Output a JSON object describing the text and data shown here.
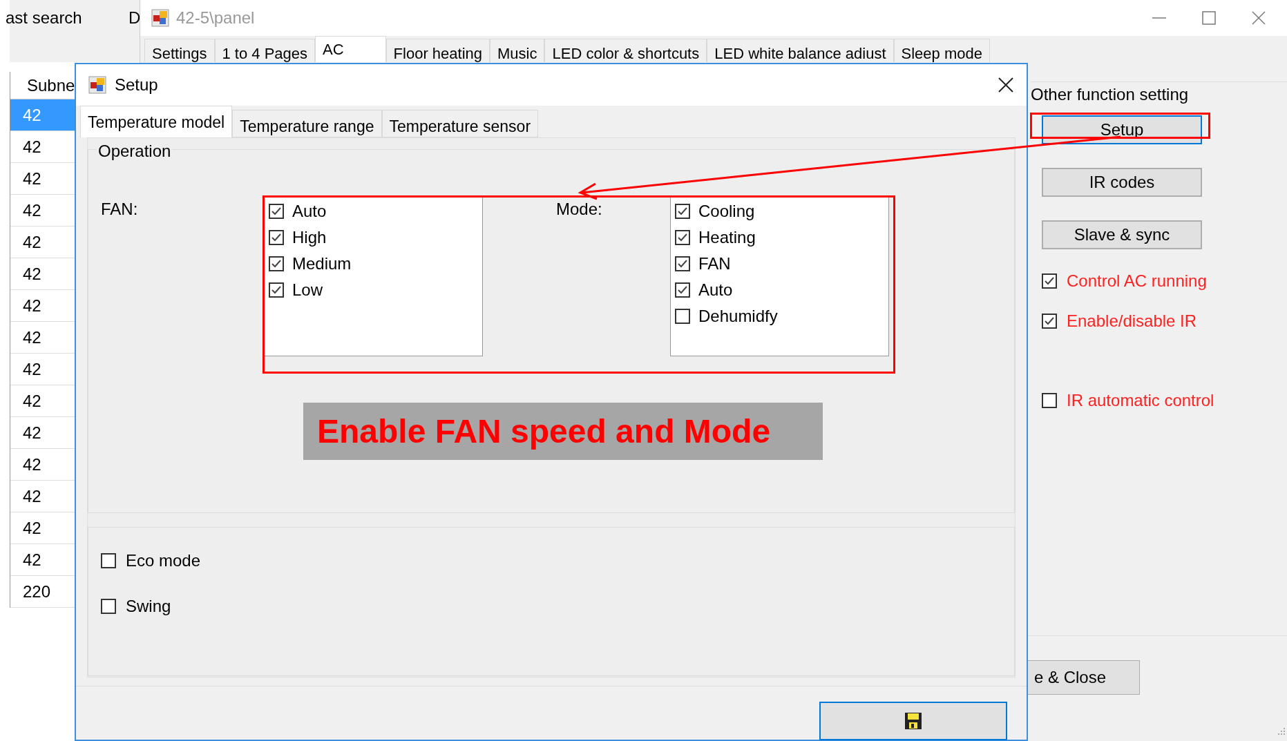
{
  "background_app": {
    "search_label": "ast search",
    "cut_label": "D",
    "table": {
      "columns": [
        "Subne"
      ],
      "rows": [
        {
          "cells": [
            "42"
          ],
          "selected": true
        },
        {
          "cells": [
            "42"
          ],
          "selected": false
        },
        {
          "cells": [
            "42"
          ],
          "selected": false
        },
        {
          "cells": [
            "42"
          ],
          "selected": false
        },
        {
          "cells": [
            "42"
          ],
          "selected": false
        },
        {
          "cells": [
            "42"
          ],
          "selected": false
        },
        {
          "cells": [
            "42"
          ],
          "selected": false
        },
        {
          "cells": [
            "42"
          ],
          "selected": false
        },
        {
          "cells": [
            "42"
          ],
          "selected": false
        },
        {
          "cells": [
            "42"
          ],
          "selected": false
        },
        {
          "cells": [
            "42"
          ],
          "selected": false
        },
        {
          "cells": [
            "42"
          ],
          "selected": false
        },
        {
          "cells": [
            "42"
          ],
          "selected": false
        },
        {
          "cells": [
            "42"
          ],
          "selected": false
        },
        {
          "cells": [
            "42"
          ],
          "selected": false
        },
        {
          "cells": [
            "220"
          ],
          "selected": false
        }
      ]
    }
  },
  "panel_window": {
    "title": "42-5\\panel",
    "tabs": [
      {
        "label": "Settings",
        "selected": false
      },
      {
        "label": "1 to 4 Pages",
        "selected": false
      },
      {
        "label": "AC",
        "selected": true
      },
      {
        "label": "Floor heating",
        "selected": false
      },
      {
        "label": "Music",
        "selected": false
      },
      {
        "label": "LED color & shortcuts",
        "selected": false
      },
      {
        "label": "LED white balance adiust",
        "selected": false
      },
      {
        "label": "Sleep mode",
        "selected": false
      }
    ],
    "other_function_setting": {
      "title": "Other function setting",
      "buttons": [
        {
          "label": "Setup",
          "focused": true
        },
        {
          "label": "IR codes",
          "focused": false
        },
        {
          "label": "Slave & sync",
          "focused": false
        }
      ],
      "checkboxes": [
        {
          "label": "Control AC running",
          "checked": true
        },
        {
          "label": "Enable/disable IR",
          "checked": true
        },
        {
          "label": "IR automatic control",
          "checked": false
        }
      ]
    },
    "close_button_label": "e & Close"
  },
  "setup_dialog": {
    "title": "Setup",
    "tabs": [
      {
        "label": "Temperature model",
        "selected": true
      },
      {
        "label": "Temperature range",
        "selected": false
      },
      {
        "label": "Temperature sensor",
        "selected": false
      }
    ],
    "operation": {
      "title": "Operation",
      "fan": {
        "label": "FAN:",
        "options": [
          {
            "label": "Auto",
            "checked": true
          },
          {
            "label": "High",
            "checked": true
          },
          {
            "label": "Medium",
            "checked": true
          },
          {
            "label": "Low",
            "checked": true
          }
        ]
      },
      "mode": {
        "label": "Mode:",
        "options": [
          {
            "label": "Cooling",
            "checked": true
          },
          {
            "label": "Heating",
            "checked": true
          },
          {
            "label": "FAN",
            "checked": true
          },
          {
            "label": "Auto",
            "checked": true
          },
          {
            "label": "Dehumidfy",
            "checked": false
          }
        ]
      }
    },
    "options": [
      {
        "label": "Eco mode",
        "checked": false
      },
      {
        "label": "Swing",
        "checked": false
      }
    ],
    "save_button": {
      "focused": true
    }
  },
  "annotation": {
    "text": "Enable FAN speed and Mode"
  }
}
